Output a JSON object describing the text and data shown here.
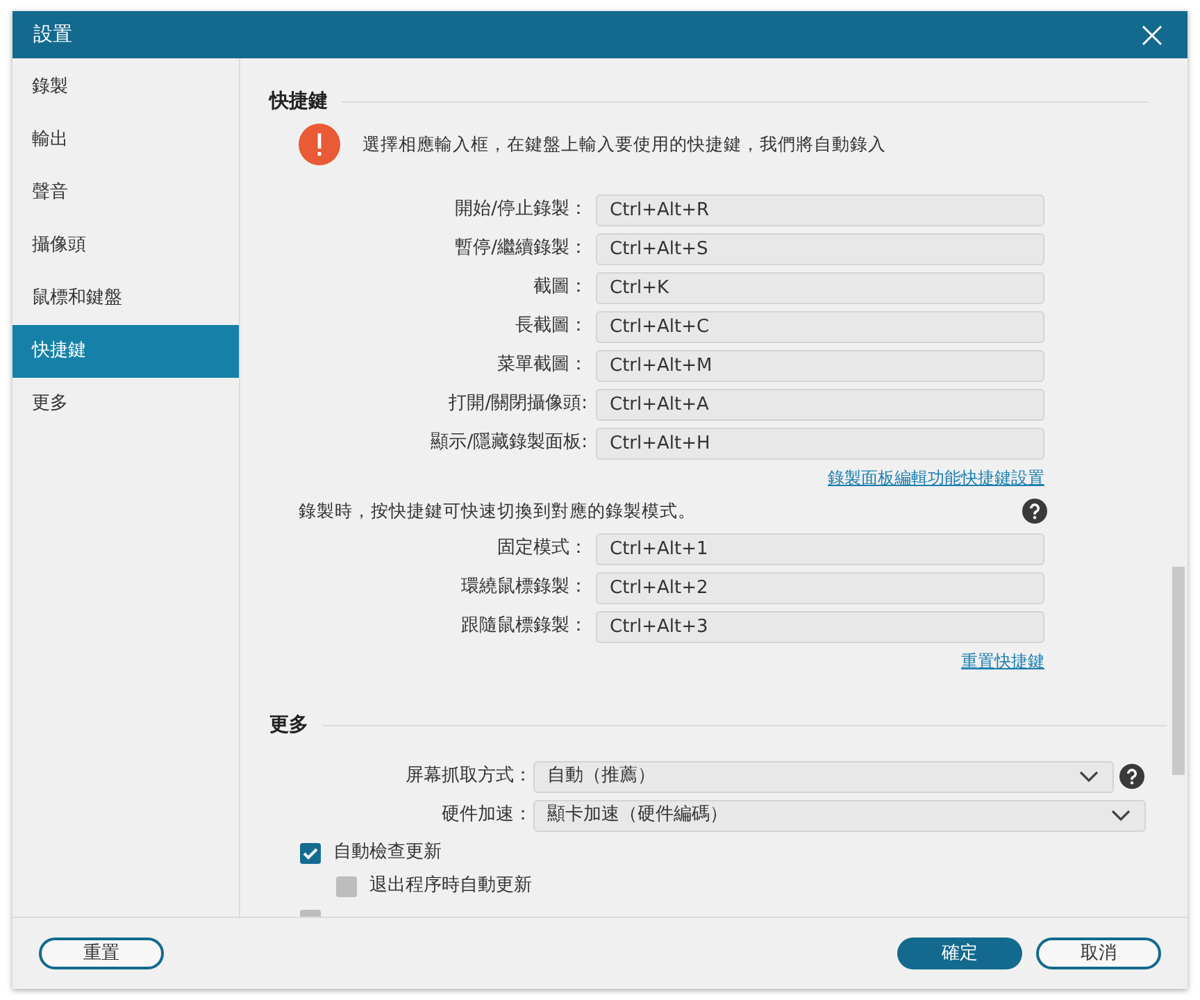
{
  "window": {
    "title": "設置"
  },
  "sidebar": {
    "items": [
      {
        "label": "錄製",
        "selected": false
      },
      {
        "label": "輸出",
        "selected": false
      },
      {
        "label": "聲音",
        "selected": false
      },
      {
        "label": "攝像頭",
        "selected": false
      },
      {
        "label": "鼠標和鍵盤",
        "selected": false
      },
      {
        "label": "快捷鍵",
        "selected": true
      },
      {
        "label": "更多",
        "selected": false
      }
    ]
  },
  "shortcuts": {
    "heading": "快捷鍵",
    "notice": "選擇相應輸入框，在鍵盤上輸入要使用的快捷鍵，我們將自動錄入",
    "rows": [
      {
        "label": "開始/停止錄製：",
        "value": "Ctrl+Alt+R"
      },
      {
        "label": "暫停/繼續錄製：",
        "value": "Ctrl+Alt+S"
      },
      {
        "label": "截圖：",
        "value": "Ctrl+K"
      },
      {
        "label": "長截圖：",
        "value": "Ctrl+Alt+C"
      },
      {
        "label": "菜單截圖：",
        "value": "Ctrl+Alt+M"
      },
      {
        "label": "打開/關閉攝像頭:",
        "value": "Ctrl+Alt+A"
      },
      {
        "label": "顯示/隱藏錄製面板:",
        "value": "Ctrl+Alt+H"
      }
    ],
    "panel_link": "錄製面板編輯功能快捷鍵設置",
    "mode_note": "錄製時，按快捷鍵可快速切換到對應的錄製模式。",
    "mode_rows": [
      {
        "label": "固定模式：",
        "value": "Ctrl+Alt+1"
      },
      {
        "label": "環繞鼠標錄製：",
        "value": "Ctrl+Alt+2"
      },
      {
        "label": "跟隨鼠標錄製：",
        "value": "Ctrl+Alt+3"
      }
    ],
    "reset_link": "重置快捷鍵"
  },
  "more": {
    "heading": "更多",
    "selects": [
      {
        "label": "屏幕抓取方式：",
        "value": "自動（推薦）",
        "help": true
      },
      {
        "label": "硬件加速：",
        "value": "顯卡加速（硬件編碼）",
        "help": false
      }
    ],
    "checkboxes": [
      {
        "label": "自動檢查更新",
        "checked": true,
        "children": [
          {
            "label": "退出程序時自動更新",
            "checked": false
          }
        ]
      },
      {
        "checked": false
      }
    ]
  },
  "footer": {
    "reset": "重置",
    "ok": "確定",
    "cancel": "取消"
  }
}
